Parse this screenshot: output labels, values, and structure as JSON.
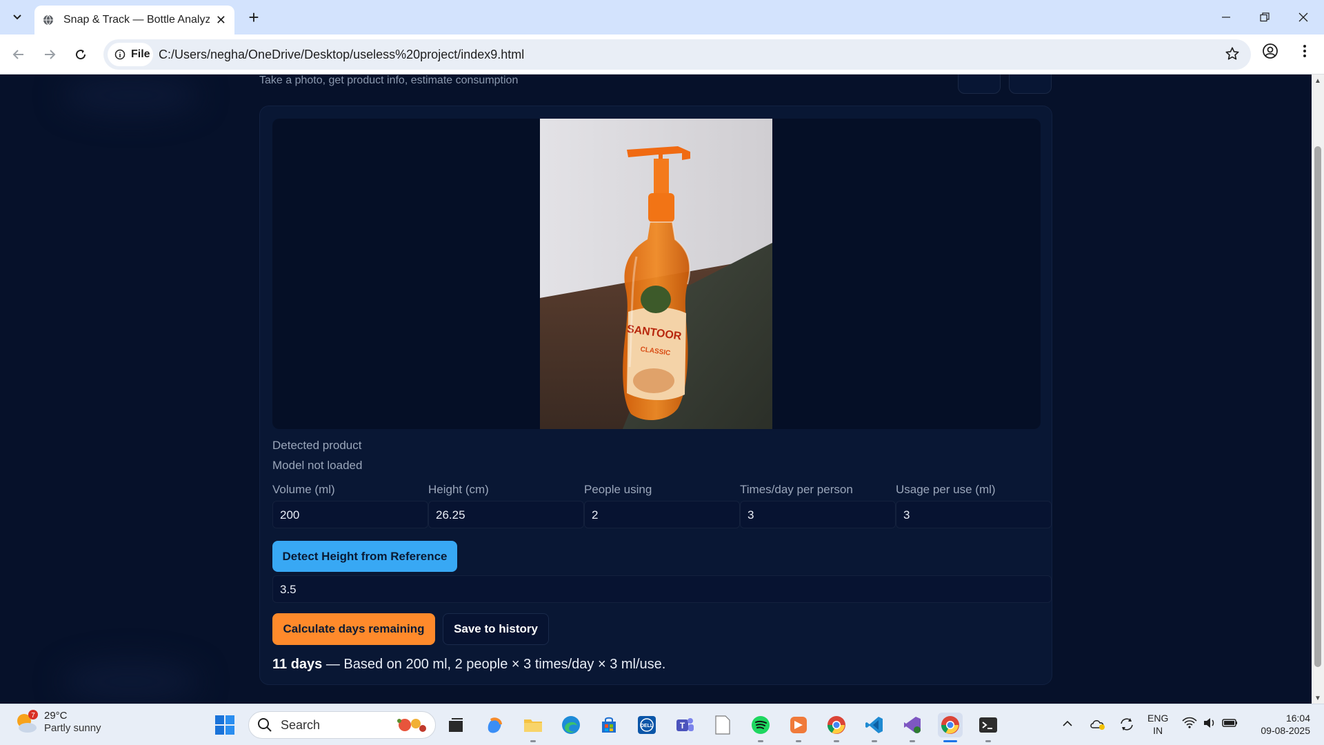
{
  "browser": {
    "tab_title": "Snap & Track — Bottle Analyzer",
    "address_chip": "File",
    "url": "C:/Users/negha/OneDrive/Desktop/useless%20project/index9.html"
  },
  "page": {
    "subtitle": "Take a photo, get product info, estimate consumption",
    "detected_label": "Detected product",
    "detected_value": "Model not loaded",
    "fields": [
      {
        "label": "Volume (ml)",
        "value": "200"
      },
      {
        "label": "Height (cm)",
        "value": "26.25"
      },
      {
        "label": "People using",
        "value": "2"
      },
      {
        "label": "Times/day per person",
        "value": "3"
      },
      {
        "label": "Usage per use (ml)",
        "value": "3"
      }
    ],
    "detect_button": "Detect Height from Reference",
    "reference_value": "3.5",
    "calc_button": "Calculate days remaining",
    "save_button": "Save to history",
    "result_days": "11 days",
    "result_text": " — Based on 200 ml, 2 people × 3 times/day × 3 ml/use."
  },
  "taskbar": {
    "temperature": "29°C",
    "weather": "Partly sunny",
    "weather_badge": "7",
    "search": "Search",
    "lang_top": "ENG",
    "lang_bottom": "IN",
    "time": "16:04",
    "date": "09-08-2025"
  },
  "colors": {
    "accent_blue": "#38a8f4",
    "accent_orange": "#ff8a2b",
    "page_bg": "#06112a"
  }
}
